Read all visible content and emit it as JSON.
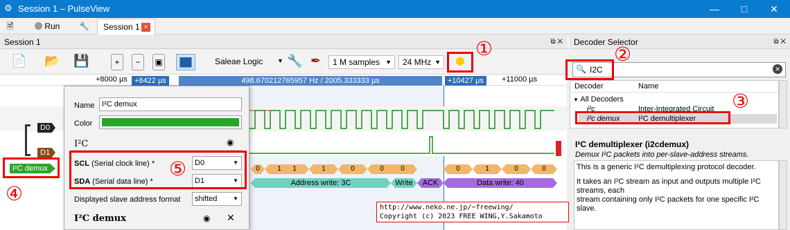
{
  "window": {
    "title": "Session 1 – PulseView"
  },
  "tabs": {
    "run_label": "Run",
    "session_tab_label": "Session 1",
    "session_tab_close": "×"
  },
  "session_header": {
    "title": "Session 1"
  },
  "toolbar": {
    "device": "Saleae Logic",
    "samples": "1 M samples",
    "samplerate": "24 MHz"
  },
  "ruler": {
    "ticks": [
      "+8000 µs",
      "+11000 µs"
    ],
    "cursor_left": "+8422 µs",
    "cursor_span": "498.670212765957 Hz / 2005.333333 µs",
    "cursor_right": "+10427 µs"
  },
  "channels": {
    "d0": "D0",
    "d1": "D1",
    "decoder_label": "I²C demux"
  },
  "popup": {
    "name_label": "Name",
    "name_value": "I²C demux",
    "color_label": "Color",
    "color_value": "#2aa52a",
    "section1_title": "I²C",
    "scl_label": "SCL",
    "scl_desc": "(Serial clock line) *",
    "scl_value": "D0",
    "sda_label": "SDA",
    "sda_desc": "(Serial data line) *",
    "sda_value": "D1",
    "address_format_label": "Displayed slave address format",
    "address_format_value": "shifted",
    "section2_title": "I²C demux"
  },
  "trace_annotations": {
    "bits": [
      "0",
      "1",
      "1",
      "1",
      "0",
      "0",
      "0",
      "0",
      "1"
    ],
    "address_write": "Address write: 3C",
    "write": "Write",
    "ack": "ACK",
    "data_write": "Data write: 40"
  },
  "decoder_selector": {
    "title": "Decoder Selector",
    "search_value": "I2C",
    "col_decoder": "Decoder",
    "col_name": "Name",
    "group": "All Decoders",
    "rows": [
      {
        "decoder": "i²c",
        "name": "Inter-Integrated Circuit"
      },
      {
        "decoder": "i²c demux",
        "name": "I²C demultiplexer"
      }
    ],
    "detail_title": "I²C demultiplexer (i2cdemux)",
    "detail_subtitle": "Demux I²C packets into per-slave-address streams.",
    "detail_text1": "This is a generic I²C demultiplexing protocol decoder.",
    "detail_text2": "It takes an I²C stream as input and outputs multiple I²C streams, each",
    "detail_text3": "stream containing only I²C packets for one specific I²C slave."
  },
  "callouts": [
    "①",
    "②",
    "③",
    "④",
    "⑤"
  ],
  "credit": {
    "line1": "http://www.neko.ne.jp/~freewing/",
    "line2": "Copyright (c) 2023 FREE WING,Y.Sakamoto"
  },
  "colors": {
    "titlebar": "#0b7bd0",
    "trace_green": "#1a8f1a",
    "trace_red": "#d22",
    "annot_orange": "#f0b66b",
    "annot_teal": "#6fd3c2",
    "annot_purple": "#a66ae0",
    "callout_red": "#e00"
  }
}
